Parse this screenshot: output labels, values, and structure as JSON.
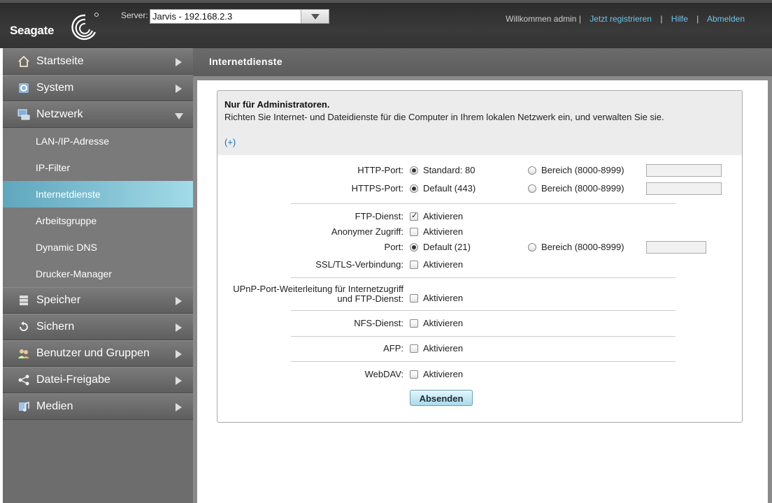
{
  "header": {
    "logo_text": "Seagate",
    "server_label": "Server:",
    "server_value": "Jarvis - 192.168.2.3",
    "welcome": "Willkommen admin |",
    "register": "Jetzt registrieren",
    "help": "Hilfe",
    "logout": "Abmelden",
    "separator": "|"
  },
  "sidebar": {
    "main_items": [
      {
        "label": "Startseite",
        "icon": "home-icon"
      },
      {
        "label": "System",
        "icon": "system-icon"
      },
      {
        "label": "Netzwerk",
        "icon": "network-icon"
      },
      {
        "label": "Speicher",
        "icon": "storage-icon"
      },
      {
        "label": "Sichern",
        "icon": "backup-icon"
      },
      {
        "label": "Benutzer und Gruppen",
        "icon": "users-icon"
      },
      {
        "label": "Datei-Freigabe",
        "icon": "share-icon"
      },
      {
        "label": "Medien",
        "icon": "media-icon"
      }
    ],
    "sub_items": [
      {
        "label": "LAN-/IP-Adresse"
      },
      {
        "label": "IP-Filter"
      },
      {
        "label": "Internetdienste",
        "active": true
      },
      {
        "label": "Arbeitsgruppe"
      },
      {
        "label": "Dynamic DNS"
      },
      {
        "label": "Drucker-Manager"
      }
    ]
  },
  "page": {
    "title": "Internetdienste",
    "notice_title": "Nur für Administratoren.",
    "notice_text": "Richten Sie Internet- und Dateidienste für die Computer in Ihrem lokalen Netzwerk ein, und verwalten Sie sie.",
    "expand": "(+)"
  },
  "form": {
    "http_label": "HTTP-Port:",
    "http_default": "Standard: 80",
    "http_range": "Bereich (8000-8999)",
    "https_label": "HTTPS-Port:",
    "https_default": "Default (443)",
    "https_range": "Bereich (8000-8999)",
    "ftp_label": "FTP-Dienst:",
    "ftp_opt": "Aktivieren",
    "anon_label": "Anonymer Zugriff:",
    "anon_opt": "Aktivieren",
    "port_label": "Port:",
    "port_default": "Default (21)",
    "port_range": "Bereich (8000-8999)",
    "ssl_label": "SSL/TLS-Verbindung:",
    "ssl_opt": "Aktivieren",
    "upnp_label_1": "UPnP-Port-Weiterleitung für Internetzugriff",
    "upnp_label_2": "und FTP-Dienst:",
    "upnp_opt": "Aktivieren",
    "nfs_label": "NFS-Dienst:",
    "nfs_opt": "Aktivieren",
    "afp_label": "AFP:",
    "afp_opt": "Aktivieren",
    "webdav_label": "WebDAV:",
    "webdav_opt": "Aktivieren",
    "submit": "Absenden",
    "ftp_checked": true
  }
}
